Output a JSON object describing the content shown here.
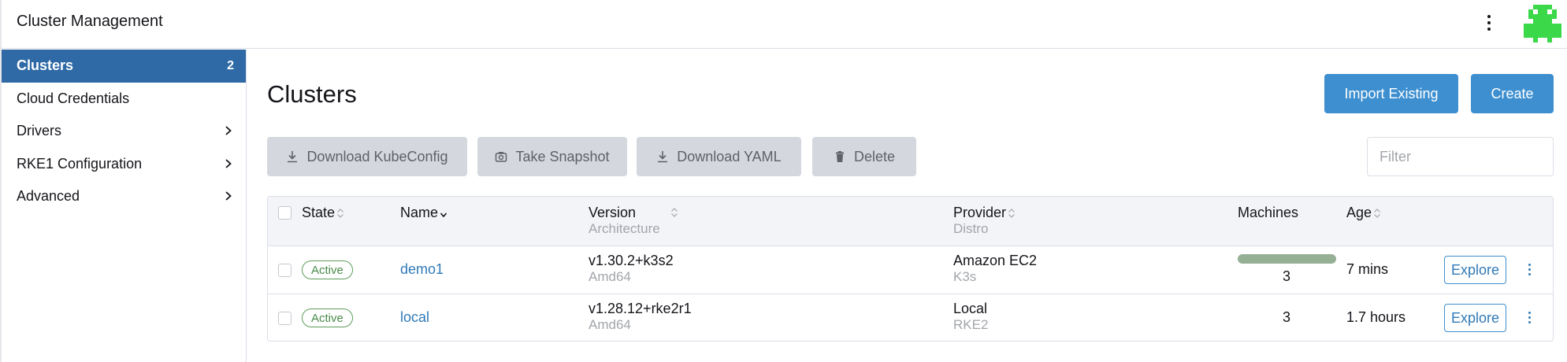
{
  "header": {
    "title": "Cluster Management",
    "menu_icon": "kebab-menu-icon",
    "avatar_icon": "user-avatar-icon",
    "avatar_color": "#3bd94a"
  },
  "sidebar": {
    "items": [
      {
        "label": "Clusters",
        "count": "2",
        "active": true
      },
      {
        "label": "Cloud Credentials"
      },
      {
        "label": "Drivers",
        "icon": "chevron-right-icon"
      },
      {
        "label": "RKE1 Configuration",
        "icon": "chevron-right-icon"
      },
      {
        "label": "Advanced",
        "icon": "chevron-right-icon"
      }
    ],
    "active_color": "#2f6aa6"
  },
  "main": {
    "title": "Clusters",
    "import_label": "Import Existing",
    "create_label": "Create",
    "primary_color": "#3d8fd0",
    "bulk_actions": [
      {
        "label": "Download KubeConfig",
        "icon": "download-icon"
      },
      {
        "label": "Take Snapshot",
        "icon": "camera-icon"
      },
      {
        "label": "Download YAML",
        "icon": "download-icon"
      },
      {
        "label": "Delete",
        "icon": "trash-icon"
      }
    ],
    "filter": {
      "placeholder": "Filter",
      "value": ""
    }
  },
  "table": {
    "columns": [
      {
        "label": "State",
        "sortable": true
      },
      {
        "label": "Name",
        "sortable": true,
        "sub": ""
      },
      {
        "label": "Version",
        "sub": "Architecture",
        "sortable": true
      },
      {
        "label": "Provider",
        "sub": "Distro",
        "sortable": true
      },
      {
        "label": "Machines"
      },
      {
        "label": "Age",
        "sortable": true
      }
    ],
    "rows": [
      {
        "state": "Active",
        "name": "demo1",
        "version": "v1.30.2+k3s2",
        "architecture": "Amd64",
        "provider": "Amazon EC2",
        "distro": "K3s",
        "machines": "3",
        "machines_bar_fraction": 1.0,
        "age": "7 mins",
        "action": "Explore"
      },
      {
        "state": "Active",
        "name": "local",
        "version": "v1.28.12+rke2r1",
        "architecture": "Amd64",
        "provider": "Local",
        "distro": "RKE2",
        "machines": "3",
        "age": "1.7 hours",
        "action": "Explore"
      }
    ]
  }
}
